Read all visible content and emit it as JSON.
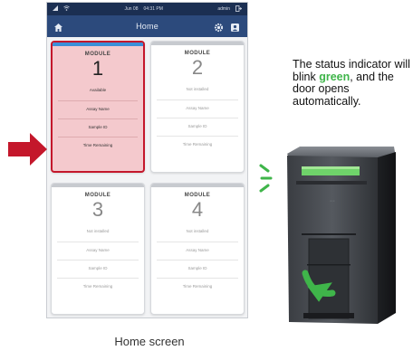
{
  "statusbar": {
    "left_icons": [
      "signal-icon",
      "wifi-icon"
    ],
    "date": "Jun 08",
    "time": "04:31 PM",
    "user": "admin",
    "right_icon": "logout-icon"
  },
  "appbar": {
    "title": "Home",
    "icons": [
      "home-icon",
      "gear-icon",
      "user-icon"
    ]
  },
  "modules": [
    {
      "label": "MODULE",
      "number": "1",
      "status": "Available",
      "assay": "Assay Name",
      "sample": "Sample ID",
      "time": "Time Remaining",
      "highlighted": true
    },
    {
      "label": "MODULE",
      "number": "2",
      "status": "Not installed",
      "assay": "Assay Name",
      "sample": "Sample ID",
      "time": "Time Remaining",
      "highlighted": false
    },
    {
      "label": "MODULE",
      "number": "3",
      "status": "Not installed",
      "assay": "Assay Name",
      "sample": "Sample ID",
      "time": "Time Remaining",
      "highlighted": false
    },
    {
      "label": "MODULE",
      "number": "4",
      "status": "Not installed",
      "assay": "Assay Name",
      "sample": "Sample ID",
      "time": "Time Remaining",
      "highlighted": false
    }
  ],
  "caption": "Home screen",
  "instruction": {
    "part1": "The status indicator will blink ",
    "highlight": "green",
    "part2": ", and the door opens automatically."
  },
  "colors": {
    "highlight_border": "#c4172b",
    "highlight_fill": "#f4c9cd",
    "blink_green": "#3fb54a",
    "appbar": "#2c4a7c"
  }
}
